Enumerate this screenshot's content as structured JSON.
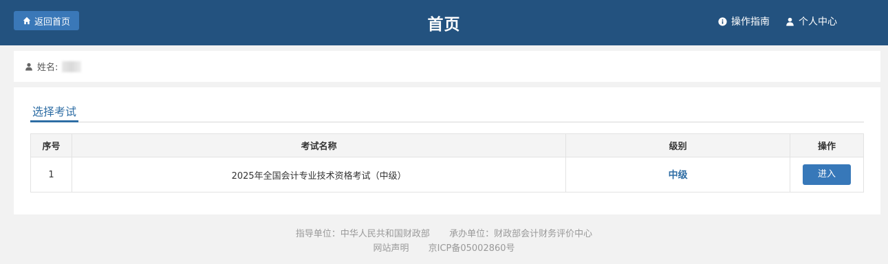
{
  "header": {
    "back_label": "返回首页",
    "title": "首页",
    "guide_label": "操作指南",
    "profile_label": "个人中心",
    "bg_color": "#23527f"
  },
  "user": {
    "name_label": "姓名:"
  },
  "tabs": {
    "active": "选择考试"
  },
  "table": {
    "headers": [
      "序号",
      "考试名称",
      "级别",
      "操作"
    ],
    "rows": [
      {
        "no": "1",
        "name": "2025年全国会计专业技术资格考试（中级）",
        "level": "中级",
        "action": "进入"
      }
    ]
  },
  "footer": {
    "guide_unit": "指导单位：中华人民共和国财政部",
    "host_unit": "承办单位：财政部会计财务评价中心",
    "statement": "网站声明",
    "icp": "京ICP备05002860号"
  }
}
